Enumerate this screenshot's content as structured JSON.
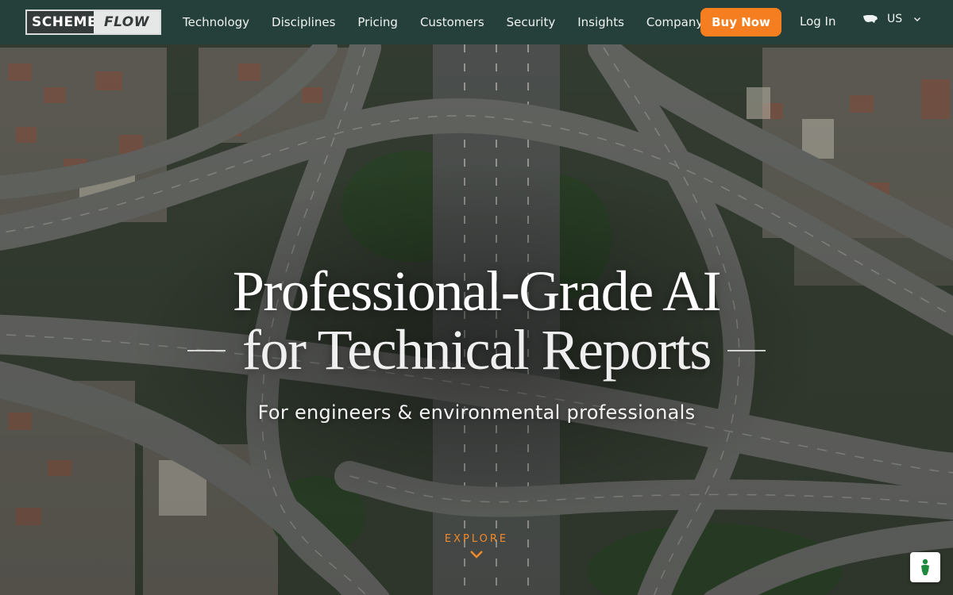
{
  "brand": {
    "logo_left": "SCHEME",
    "logo_right": "FLOW"
  },
  "nav": {
    "links": [
      "Technology",
      "Disciplines",
      "Pricing",
      "Customers",
      "Security",
      "Insights",
      "Company"
    ],
    "buy_label": "Buy Now",
    "login_label": "Log In",
    "region_label": "US",
    "region_icon": "us-map-icon",
    "chevron_icon": "chevron-down-icon"
  },
  "hero": {
    "headline_line1": "Professional-Grade AI",
    "headline_line2": "for Technical Reports",
    "subheadline": "For engineers & environmental professionals",
    "explore_label": "EXPLORE",
    "explore_icon": "chevron-down-icon"
  },
  "accessibility": {
    "icon": "accessibility-icon"
  },
  "colors": {
    "nav_bg": "#25403b",
    "accent": "#f57f20",
    "explore_text": "#f08a2c"
  }
}
